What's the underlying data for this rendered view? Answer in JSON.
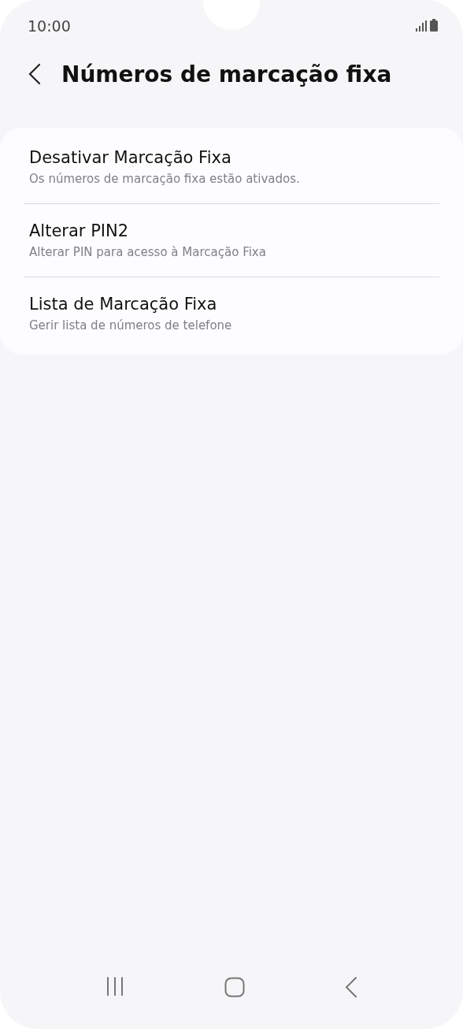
{
  "status_bar": {
    "time": "10:00"
  },
  "header": {
    "title": "Números de marcação fixa"
  },
  "items": [
    {
      "title": "Desativar Marcação Fixa",
      "subtitle": "Os números de marcação fixa estão ativados."
    },
    {
      "title": "Alterar PIN2",
      "subtitle": "Alterar PIN para acesso à Marcação Fixa"
    },
    {
      "title": "Lista de Marcação Fixa",
      "subtitle": "Gerir lista de números de telefone"
    }
  ]
}
